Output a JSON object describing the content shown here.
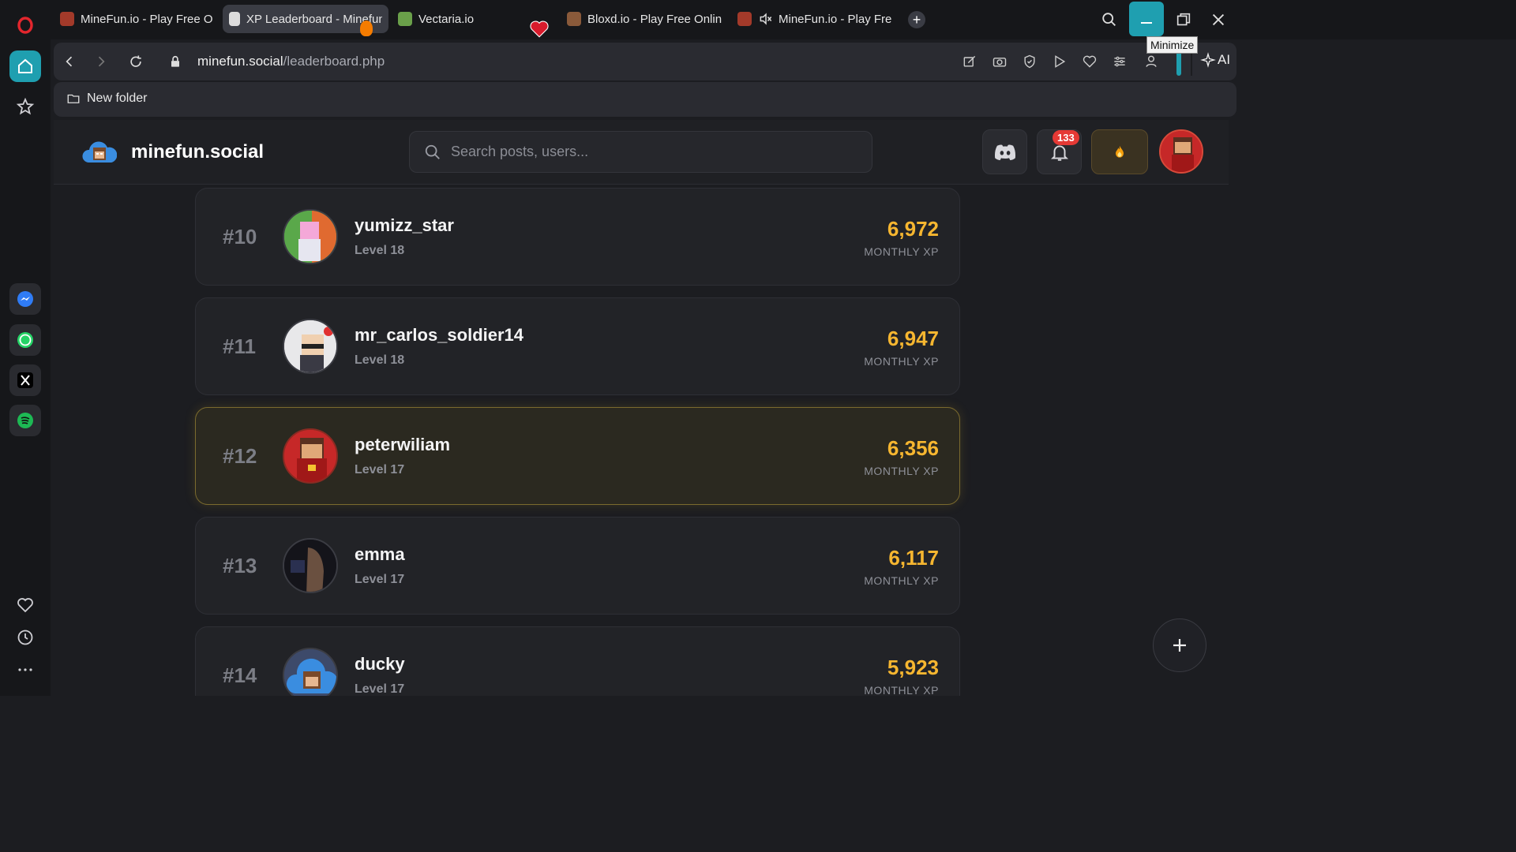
{
  "tabs": [
    {
      "label": "MineFun.io - Play Free Onl",
      "favicon_color": "#a33a2a"
    },
    {
      "label": "XP Leaderboard - Minefun",
      "favicon_color": "#dcdcdc",
      "active": true
    },
    {
      "label": "Vectaria.io",
      "favicon_color": "#6aa04a"
    },
    {
      "label": "Bloxd.io - Play Free Online",
      "favicon_color": "#8a5a3a"
    },
    {
      "label": "MineFun.io - Play Free",
      "favicon_color": "#a33a2a",
      "muted": true
    }
  ],
  "window": {
    "tooltip": "Minimize"
  },
  "address": {
    "domain": "minefun.social",
    "path": "/leaderboard.php"
  },
  "bookmarks": {
    "folder": "New folder"
  },
  "extensions": {
    "ai_label": "AI"
  },
  "site": {
    "name": "minefun.social",
    "search_placeholder": "Search posts, users...",
    "notification_count": "133"
  },
  "leaderboard": [
    {
      "rank": "#10",
      "username": "yumizz_star",
      "level": "Level 18",
      "xp": "6,972",
      "xp_label": "MONTHLY XP",
      "avatar_color": "#5aa84a"
    },
    {
      "rank": "#11",
      "username": "mr_carlos_soldier14",
      "level": "Level 18",
      "xp": "6,947",
      "xp_label": "MONTHLY XP",
      "avatar_color": "#dcdcdc"
    },
    {
      "rank": "#12",
      "username": "peterwiliam",
      "level": "Level 17",
      "xp": "6,356",
      "xp_label": "MONTHLY XP",
      "avatar_color": "#c62828",
      "highlighted": true
    },
    {
      "rank": "#13",
      "username": "emma",
      "level": "Level 17",
      "xp": "6,117",
      "xp_label": "MONTHLY XP",
      "avatar_color": "#1a1a22"
    },
    {
      "rank": "#14",
      "username": "ducky",
      "level": "Level 17",
      "xp": "5,923",
      "xp_label": "MONTHLY XP",
      "avatar_color": "#3d4a6a"
    }
  ],
  "colors": {
    "accent_xp": "#f6b630",
    "sidebar_active": "#1f9fb0",
    "brand_opera": "#e3262d"
  }
}
